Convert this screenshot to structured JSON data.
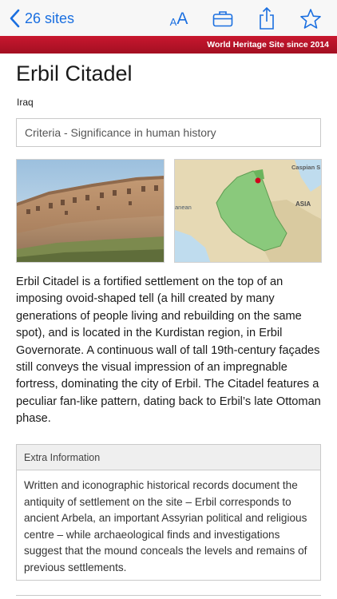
{
  "nav": {
    "back_label": "26 sites",
    "font_size_small": "A",
    "font_size_large": "A"
  },
  "banner": {
    "text": "World Heritage Site since 2014"
  },
  "site": {
    "name": "Erbil Citadel",
    "country": "Iraq",
    "criteria": "Criteria - Significance in human history",
    "description": "Erbil Citadel is a fortified settlement on the top of an imposing ovoid-shaped tell (a hill created by many generations of people living and rebuilding on the same spot), and is located in the Kurdistan region, in Erbil Governorate. A continuous wall of tall 19th-century façades still conveys the visual impression of an impregnable fortress, dominating the city of Erbil. The Citadel features a peculiar fan-like pattern, dating back to Erbil’s late Ottoman phase."
  },
  "map": {
    "label_caspian": "Caspian S",
    "label_asia": "ASIA",
    "label_west": "anean"
  },
  "extra": {
    "header": "Extra Information",
    "text": "Written and iconographic historical records document the antiquity of settlement on the site – Erbil corresponds to ancient Arbela, an important Assyrian political and religious centre – while archaeological finds and investigations suggest that the mound conceals the levels and remains of previous settlements."
  },
  "colors": {
    "accent": "#1a6fe0",
    "banner": "#b8132a",
    "marker": "#d0021b"
  },
  "icons": [
    "chevron-left-icon",
    "font-size-icon",
    "briefcase-icon",
    "share-icon",
    "star-icon"
  ]
}
